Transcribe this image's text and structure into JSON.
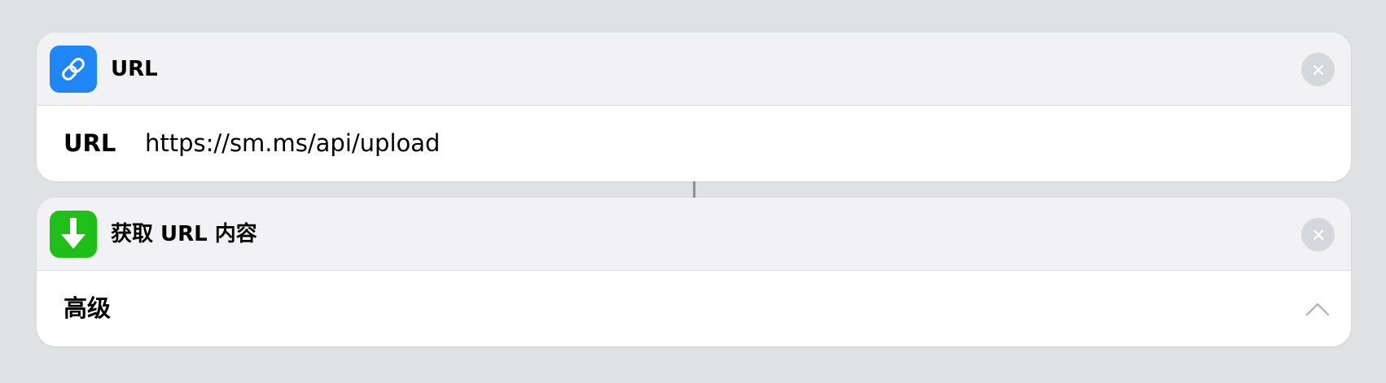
{
  "actions": {
    "url": {
      "title": "URL",
      "icon": "link-icon",
      "icon_color": "#1e86f5",
      "param_label": "URL",
      "param_value": "https://sm.ms/api/upload"
    },
    "get_contents": {
      "title": "获取 URL 内容",
      "icon": "download-arrow-icon",
      "icon_color": "#1fbf1a",
      "advanced_label": "高级"
    }
  },
  "colors": {
    "background": "#e0e1e3",
    "card": "#ffffff",
    "header": "#f2f2f5"
  }
}
